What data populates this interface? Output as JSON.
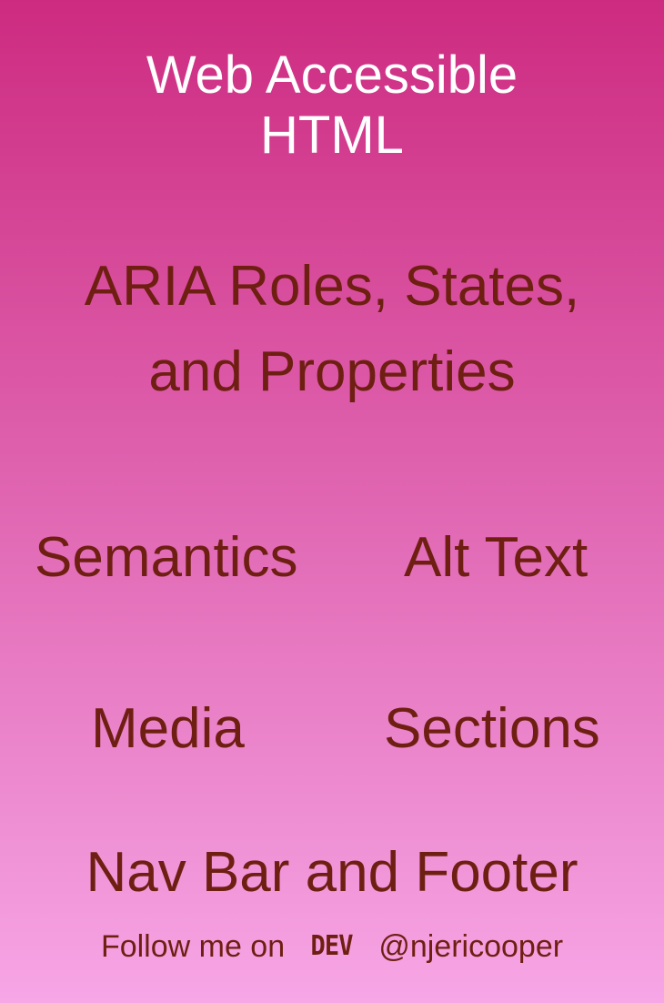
{
  "title": {
    "line1": "Web Accessible",
    "line2": "HTML"
  },
  "topics": {
    "aria_line1": "ARIA Roles, States,",
    "aria_line2": "and Properties",
    "semantics": "Semantics",
    "alt_text": "Alt Text",
    "media": "Media",
    "sections": "Sections",
    "nav_footer": "Nav Bar and Footer"
  },
  "footer": {
    "follow_text": "Follow me on",
    "platform_logo": "DEV",
    "handle": "@njericooper"
  },
  "colors": {
    "gradient_top": "#cd2b80",
    "gradient_bottom": "#f7a6e6",
    "title_text": "#ffffff",
    "topic_text": "#6e1f12"
  }
}
